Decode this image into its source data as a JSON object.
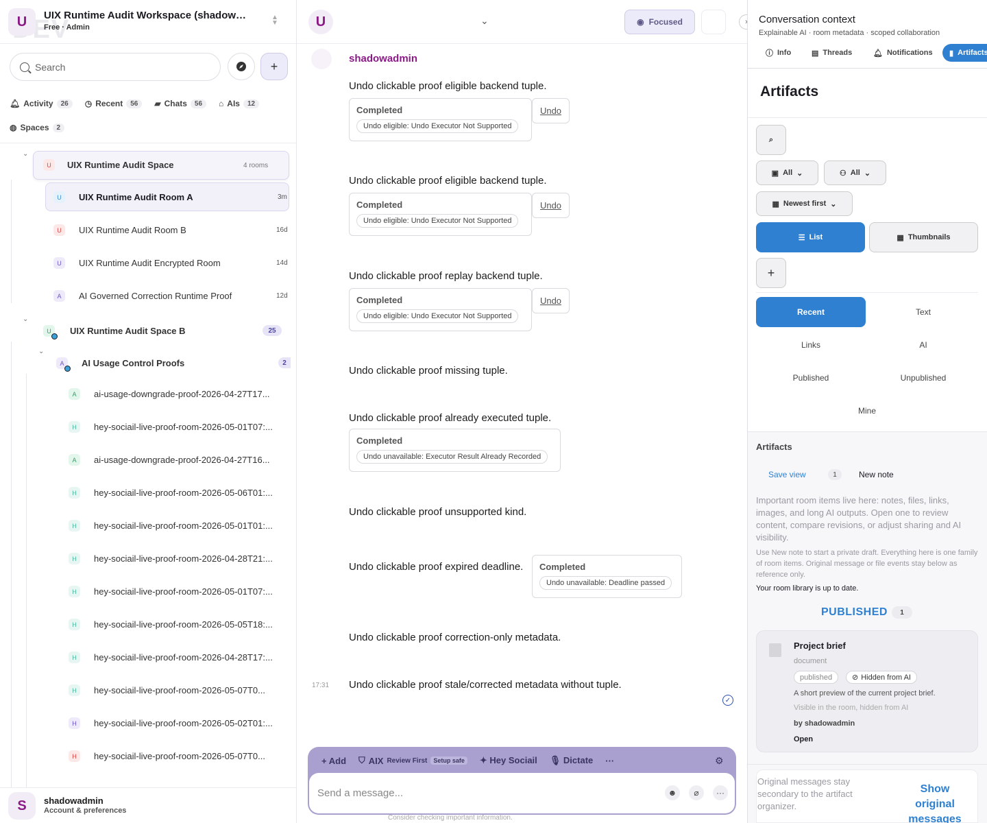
{
  "sidebar": {
    "workspace": {
      "avatar": "U",
      "watermark": "DEV",
      "title": "UIX Runtime Audit Workspace (shadow…",
      "subtitle": "Free · Admin"
    },
    "search_placeholder": "Search",
    "tabs": [
      {
        "label": "Activity",
        "count": "26",
        "icon": "bell-icon"
      },
      {
        "label": "Recent",
        "count": "56",
        "icon": "clock-icon"
      },
      {
        "label": "Chats",
        "count": "56",
        "icon": "chat-icon"
      },
      {
        "label": "AIs",
        "count": "12",
        "icon": "robot-icon"
      },
      {
        "label": "Spaces",
        "count": "2",
        "icon": "globe-icon"
      }
    ],
    "space_a": {
      "avatar": "U",
      "name": "UIX Runtime Audit Space",
      "meta": "4 rooms"
    },
    "rooms_a": [
      {
        "avatar": "U",
        "name": "UIX Runtime Audit Room A",
        "time": "3m"
      },
      {
        "avatar": "U",
        "name": "UIX Runtime Audit Room B",
        "time": "16d"
      },
      {
        "avatar": "U",
        "name": "UIX Runtime Audit Encrypted Room",
        "time": "14d"
      },
      {
        "avatar": "A",
        "name": "AI Governed Correction Runtime Proof",
        "time": "12d"
      }
    ],
    "space_b": {
      "avatar": "U",
      "name": "UIX Runtime Audit Space B",
      "count": "25"
    },
    "subspace": {
      "avatar": "A",
      "name": "AI Usage Control Proofs",
      "count": "2"
    },
    "subrooms": [
      {
        "avatar": "A",
        "name": "ai-usage-downgrade-proof-2026-04-27T17..."
      },
      {
        "avatar": "H",
        "name": "hey-sociail-live-proof-room-2026-05-01T07:..."
      },
      {
        "avatar": "A",
        "name": "ai-usage-downgrade-proof-2026-04-27T16..."
      },
      {
        "avatar": "H",
        "name": "hey-sociail-live-proof-room-2026-05-06T01:..."
      },
      {
        "avatar": "H",
        "name": "hey-sociail-live-proof-room-2026-05-01T01:..."
      },
      {
        "avatar": "H",
        "name": "hey-sociail-live-proof-room-2026-04-28T21:..."
      },
      {
        "avatar": "H",
        "name": "hey-sociail-live-proof-room-2026-05-01T07:..."
      },
      {
        "avatar": "H",
        "name": "hey-sociail-live-proof-room-2026-05-05T18:..."
      },
      {
        "avatar": "H",
        "name": "hey-sociail-live-proof-room-2026-04-28T17:..."
      },
      {
        "avatar": "H",
        "name": "hey-sociail-live-proof-room-2026-05-07T0..."
      },
      {
        "avatar": "H",
        "name": "hey-sociail-live-proof-room-2026-05-02T01:..."
      },
      {
        "avatar": "H",
        "name": "hey-sociail-live-proof-room-2026-05-07T0..."
      }
    ],
    "footer": {
      "avatar": "S",
      "name": "shadowadmin",
      "sub": "Account & preferences"
    }
  },
  "main": {
    "header": {
      "avatar": "U",
      "focused_label": "Focused"
    },
    "sender": "shadowadmin",
    "messages": [
      {
        "text": "Undo clickable proof eligible backend tuple.",
        "status": "Completed",
        "detail": "Undo eligible: Undo Executor Not Supported",
        "undo": "Undo"
      },
      {
        "text": "Undo clickable proof eligible backend tuple.",
        "status": "Completed",
        "detail": "Undo eligible: Undo Executor Not Supported",
        "undo": "Undo"
      },
      {
        "text": "Undo clickable proof replay backend tuple.",
        "status": "Completed",
        "detail": "Undo eligible: Undo Executor Not Supported",
        "undo": "Undo"
      },
      {
        "text": "Undo clickable proof missing tuple."
      },
      {
        "text": "Undo clickable proof already executed tuple.",
        "status": "Completed",
        "detail": "Undo unavailable: Executor Result Already Recorded"
      },
      {
        "text": "Undo clickable proof unsupported kind."
      },
      {
        "text": "Undo clickable proof expired deadline.",
        "status": "Completed",
        "detail": "Undo unavailable: Deadline passed"
      },
      {
        "text": "Undo clickable proof correction-only metadata."
      },
      {
        "text": "Undo clickable proof stale/corrected metadata without tuple.",
        "time": "17:31"
      }
    ],
    "composer": {
      "add": "Add",
      "aix": "AIX",
      "review": "Review First",
      "setup": "Setup safe",
      "hey": "Hey Sociail",
      "dictate": "Dictate",
      "more": "···",
      "placeholder": "Send a message...",
      "hint": "Consider checking important information."
    }
  },
  "right": {
    "title": "Conversation context",
    "subtitle": "Explainable AI · room metadata · scoped collaboration",
    "tabs": [
      {
        "label": "Info",
        "icon": "info-icon"
      },
      {
        "label": "Threads",
        "icon": "threads-icon"
      },
      {
        "label": "Notifications",
        "icon": "bell-icon"
      },
      {
        "label": "Artifacts",
        "icon": "document-icon"
      }
    ],
    "heading": "Artifacts",
    "filters": {
      "type": "All",
      "owner": "All",
      "sort": "Newest first",
      "list": "List",
      "thumbs": "Thumbnails"
    },
    "categories": [
      "Recent",
      "Text",
      "Links",
      "AI",
      "Published",
      "Unpublished",
      "Mine"
    ],
    "section_title": "Artifacts",
    "save_view": "Save view",
    "note_count": "1",
    "new_note": "New note",
    "info1": "Important room items live here: notes, files, links, images, and long AI outputs. Open one to review content, compare revisions, or adjust sharing and AI visibility.",
    "info2": "Use New note to start a private draft. Everything here is one family of room items. Original message or file events stay below as reference only.",
    "uptodate": "Your room library is up to date.",
    "published_label": "PUBLISHED",
    "published_count": "1",
    "artifact": {
      "title": "Project brief",
      "kind": "document",
      "status": "published",
      "visibility": "Hidden from AI",
      "desc": "A short preview of the current project brief.",
      "visnote": "Visible in the room, hidden from AI",
      "by": "by shadowadmin",
      "open": "Open"
    },
    "footer_text": "Original messages stay secondary to the artifact organizer.",
    "footer_btn": "Show original messages"
  },
  "colors": {
    "brand": "#8b1a86",
    "accent": "#2f80d0",
    "composer": "#a9a0cf",
    "focused": "#ecebfa"
  }
}
